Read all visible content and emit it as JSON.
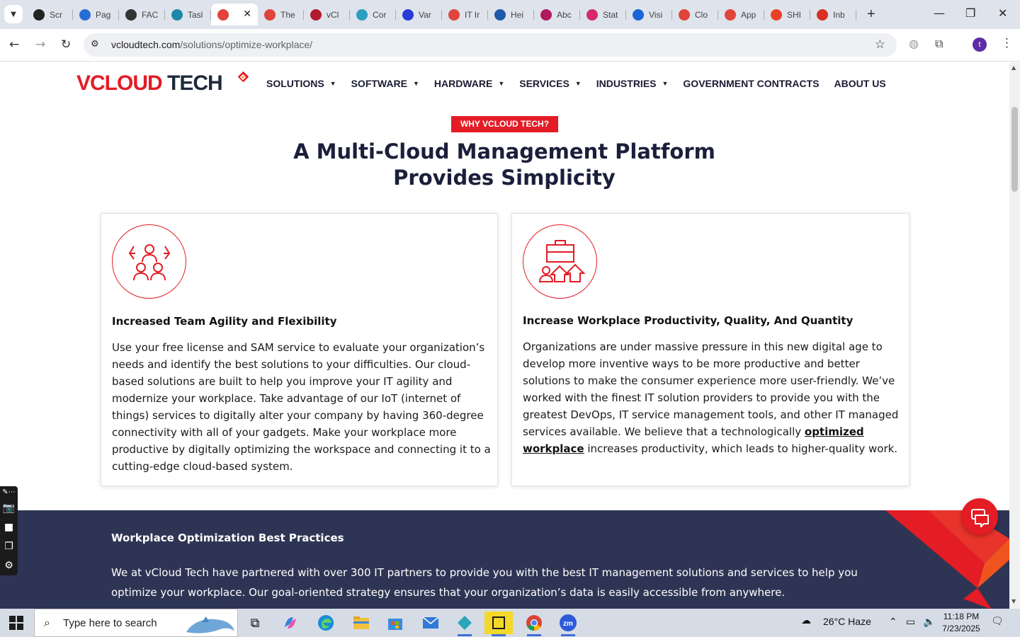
{
  "browser": {
    "tabs": [
      {
        "label": "Scr",
        "color": "#222"
      },
      {
        "label": "Pag",
        "color": "#2a6cd6"
      },
      {
        "label": "FAC",
        "color": "#333"
      },
      {
        "label": "Tasl",
        "color": "#1e88a8"
      },
      {
        "label": "",
        "color": "#e0443a",
        "active": true
      },
      {
        "label": "The",
        "color": "#e0443a"
      },
      {
        "label": "vCl",
        "color": "#b01a2e"
      },
      {
        "label": "Cor",
        "color": "#2a9fbf"
      },
      {
        "label": "Var",
        "color": "#2a3ad6"
      },
      {
        "label": "IT Ir",
        "color": "#e0443a"
      },
      {
        "label": "Hei",
        "color": "#1e5aa8"
      },
      {
        "label": "Abc",
        "color": "#b01a5e"
      },
      {
        "label": "Stat",
        "color": "#d42a6a"
      },
      {
        "label": "Visi",
        "color": "#1a66d6"
      },
      {
        "label": "Clo",
        "color": "#e0443a"
      },
      {
        "label": "App",
        "color": "#e0443a"
      },
      {
        "label": "SHI",
        "color": "#e8412a"
      },
      {
        "label": "Inb",
        "color": "#d93025"
      }
    ],
    "url_host": "vcloudtech.com",
    "url_path": "/solutions/optimize-workplace/",
    "profile_initial": "t"
  },
  "site": {
    "logo": {
      "v": "V",
      "cloud": "CLOUD",
      "tech": " TECH"
    },
    "nav": [
      {
        "label": "SOLUTIONS",
        "dropdown": true
      },
      {
        "label": "SOFTWARE",
        "dropdown": true
      },
      {
        "label": "HARDWARE",
        "dropdown": true
      },
      {
        "label": "SERVICES",
        "dropdown": true
      },
      {
        "label": "INDUSTRIES",
        "dropdown": true
      },
      {
        "label": "GOVERNMENT CONTRACTS",
        "dropdown": false
      },
      {
        "label": "ABOUT US",
        "dropdown": false
      }
    ],
    "eyebrow": "WHY VCLOUD TECH?",
    "hero_line1": "A Multi-Cloud Management Platform",
    "hero_line2": "Provides Simplicity",
    "card1": {
      "title": "Increased Team Agility and Flexibility",
      "text": "Use your free license and SAM service to evaluate your organization’s needs and identify the best solutions to your difficulties. Our cloud-based solutions are built to help you improve your IT agility and modernize your workplace. Take advantage of our IoT (internet of things) services to digitally alter your company by having 360-degree connectivity with all of your gadgets. Make your workplace more productive by digitally optimizing the workspace and connecting it to a cutting-edge cloud-based system."
    },
    "card2": {
      "title": "Increase Workplace Productivity, Quality, And Quantity",
      "text_before": "Organizations are under massive pressure in this new digital age to develop more inventive ways to be more productive and better solutions to make the consumer experience more user-friendly. We’ve worked with the finest IT solution providers to provide you with the greatest DevOps, IT service management tools, and other IT managed services available. We believe that a technologically ",
      "link": "optimized workplace",
      "text_after": " increases productivity, which leads to higher-quality work."
    },
    "section": {
      "title": "Workplace Optimization Best Practices",
      "text": "We at vCloud Tech have partnered with over 300 IT partners to provide you with the best IT management solutions and services to help you optimize your workplace. Our goal-oriented strategy ensures that your organization’s data is easily accessible from anywhere."
    }
  },
  "taskbar": {
    "search_placeholder": "Type here to search",
    "weather": "26°C  Haze",
    "time": "11:18 PM",
    "date": "7/23/2025"
  },
  "colors": {
    "brand_red": "#e31c25",
    "navy": "#2e3554",
    "heading": "#1b1f3b"
  }
}
